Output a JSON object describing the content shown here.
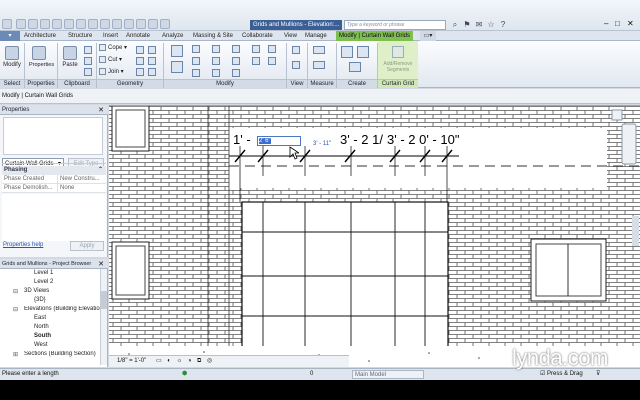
{
  "window": {
    "doc_title": "Grids and Mullions - Elevation:...",
    "search_placeholder": "Type a keyword or phrase"
  },
  "tabs": [
    "Architecture",
    "Structure",
    "Insert",
    "Annotate",
    "Analyze",
    "Massing & Site",
    "Collaborate",
    "View",
    "Manage"
  ],
  "contextual_tab": "Modify | Curtain Wall Grids",
  "ribbon": {
    "select": {
      "modify_label": "Modify",
      "panel_label": "Select"
    },
    "properties": {
      "label": "Properties",
      "panel_label": "Properties"
    },
    "clipboard": {
      "paste_label": "Paste",
      "panel_label": "Clipboard"
    },
    "geometry": {
      "cope_label": "Cope",
      "cut_label": "Cut",
      "join_label": "Join",
      "panel_label": "Geometry"
    },
    "modify": {
      "panel_label": "Modify"
    },
    "view": {
      "panel_label": "View"
    },
    "measure": {
      "panel_label": "Measure"
    },
    "create": {
      "panel_label": "Create"
    },
    "curtain_grid": {
      "add_remove_label": "Add/Remove Segments",
      "panel_label": "Curtain Grid"
    }
  },
  "options_bar": {
    "text": "Modify | Curtain Wall Grids"
  },
  "properties": {
    "title": "Properties",
    "type_selector": "Curtain Wall Grids",
    "edit_type_label": "Edit Type",
    "phasing_header": "Phasing",
    "rows": [
      {
        "name": "Phase Created",
        "value": "New Constru..."
      },
      {
        "name": "Phase Demolish...",
        "value": "None"
      }
    ],
    "help_link": "Properties help",
    "apply_label": "Apply"
  },
  "project_browser": {
    "title": "Grids and Mullions - Project Browser",
    "items": [
      {
        "label": "Level 1"
      },
      {
        "label": "Level 2"
      },
      {
        "label": "3D Views"
      },
      {
        "label": "{3D}"
      },
      {
        "label": "Elevations (Building Elevation)"
      },
      {
        "label": "East"
      },
      {
        "label": "North"
      },
      {
        "label": "South"
      },
      {
        "label": "West"
      },
      {
        "label": "Sections (Building Section)"
      }
    ]
  },
  "canvas": {
    "dimensions": [
      "1' - ",
      "3' - 2 1/",
      "3' - 2 0' - 10\""
    ],
    "dim_input_value": "2' 6\"",
    "temp_dim": "3' - 11\""
  },
  "view_bar": {
    "scale": "1/8\" = 1'-0\""
  },
  "status_bar": {
    "prompt": "Please enter a length",
    "coord": "0",
    "model": "Main Model",
    "press_drag": "Press & Drag"
  },
  "watermark": "lynda.com",
  "colors": {
    "accent": "#3b5f95",
    "contextual": "#7fbf4f"
  }
}
